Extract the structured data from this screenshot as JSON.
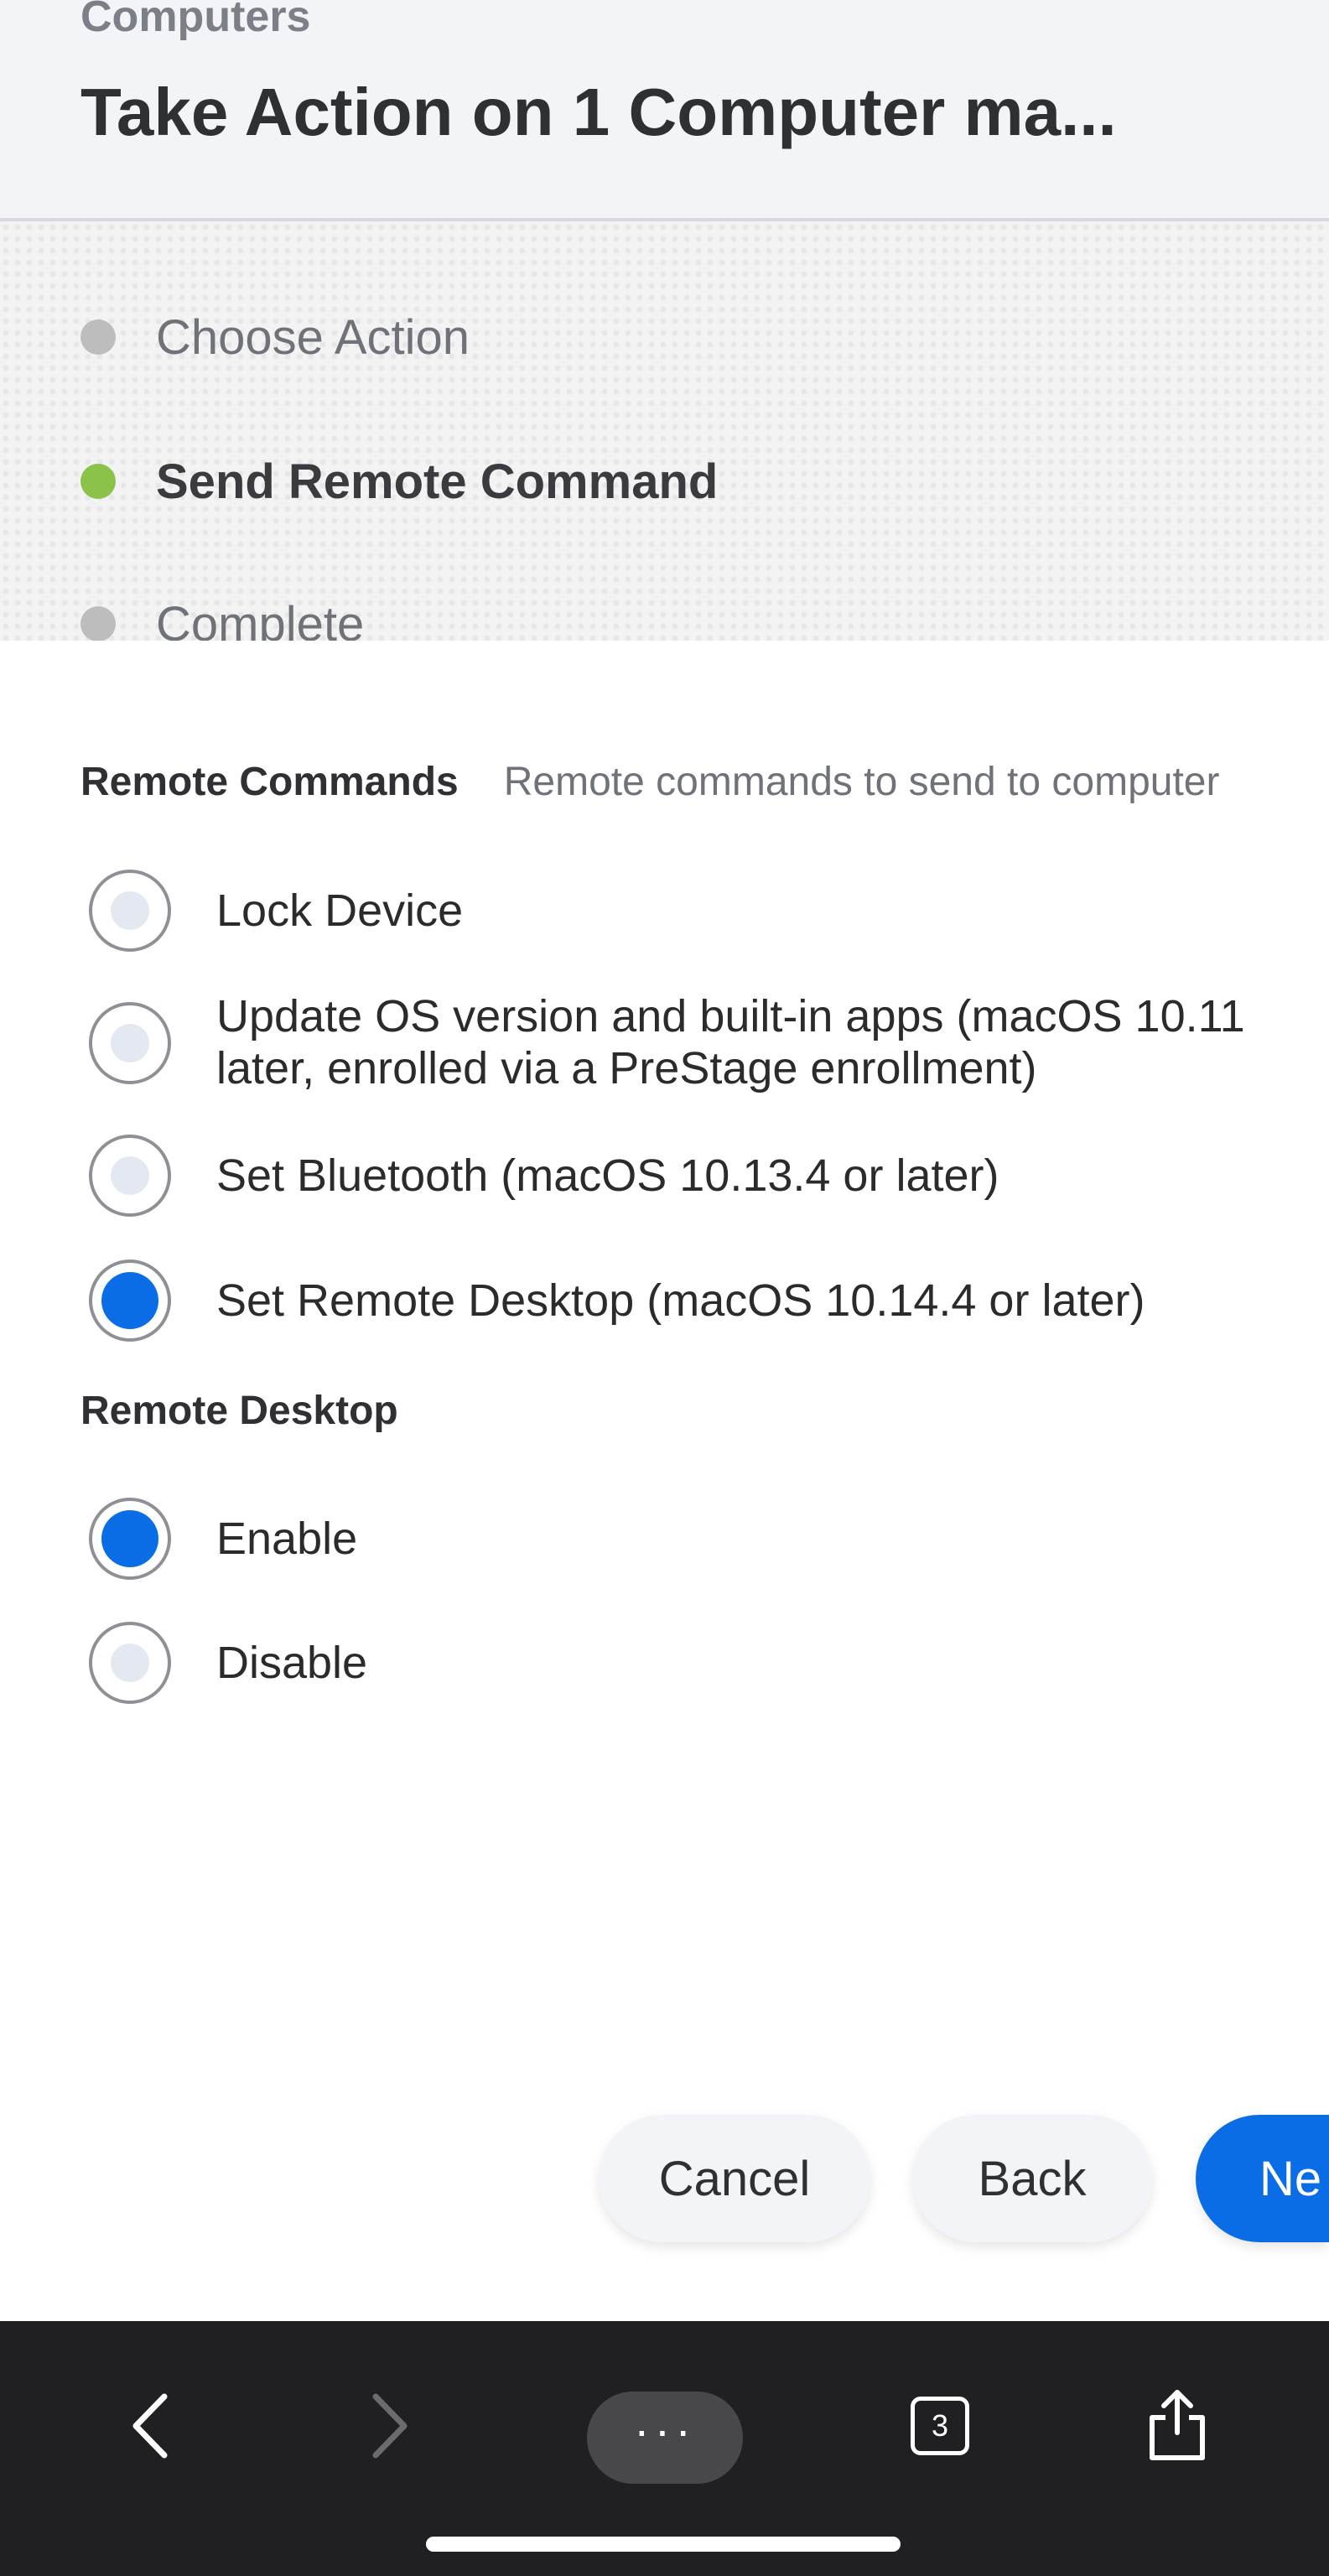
{
  "header": {
    "breadcrumb": "Computers",
    "title": "Take Action on 1 Computer ma..."
  },
  "steps": [
    {
      "label": "Choose Action",
      "active": false
    },
    {
      "label": "Send Remote Command",
      "active": true
    },
    {
      "label": "Complete",
      "active": false
    }
  ],
  "remote_commands": {
    "title": "Remote Commands",
    "description": "Remote commands to send to computer",
    "options": [
      {
        "label": "Lock Device",
        "checked": false
      },
      {
        "label_line1": "Update OS version and built-in apps (macOS 10.11",
        "label_line2": "later, enrolled via a PreStage enrollment)",
        "checked": false
      },
      {
        "label": "Set Bluetooth (macOS 10.13.4 or later)",
        "checked": false
      },
      {
        "label": "Set Remote Desktop (macOS 10.14.4 or later)",
        "checked": true
      }
    ]
  },
  "remote_desktop": {
    "title": "Remote Desktop",
    "options": [
      {
        "label": "Enable",
        "checked": true
      },
      {
        "label": "Disable",
        "checked": false
      }
    ]
  },
  "buttons": {
    "cancel": "Cancel",
    "back": "Back",
    "next": "Ne"
  },
  "toolbar": {
    "tab_count": "3",
    "more_label": "···",
    "icons": [
      "back-arrow-icon",
      "forward-arrow-icon",
      "more-icon",
      "tabs-icon",
      "share-icon"
    ]
  },
  "colors": {
    "accent": "#0a6de6",
    "active_step": "#8bc34a",
    "inactive_step": "#bdbdbd",
    "toolbar_bg": "#202022"
  }
}
